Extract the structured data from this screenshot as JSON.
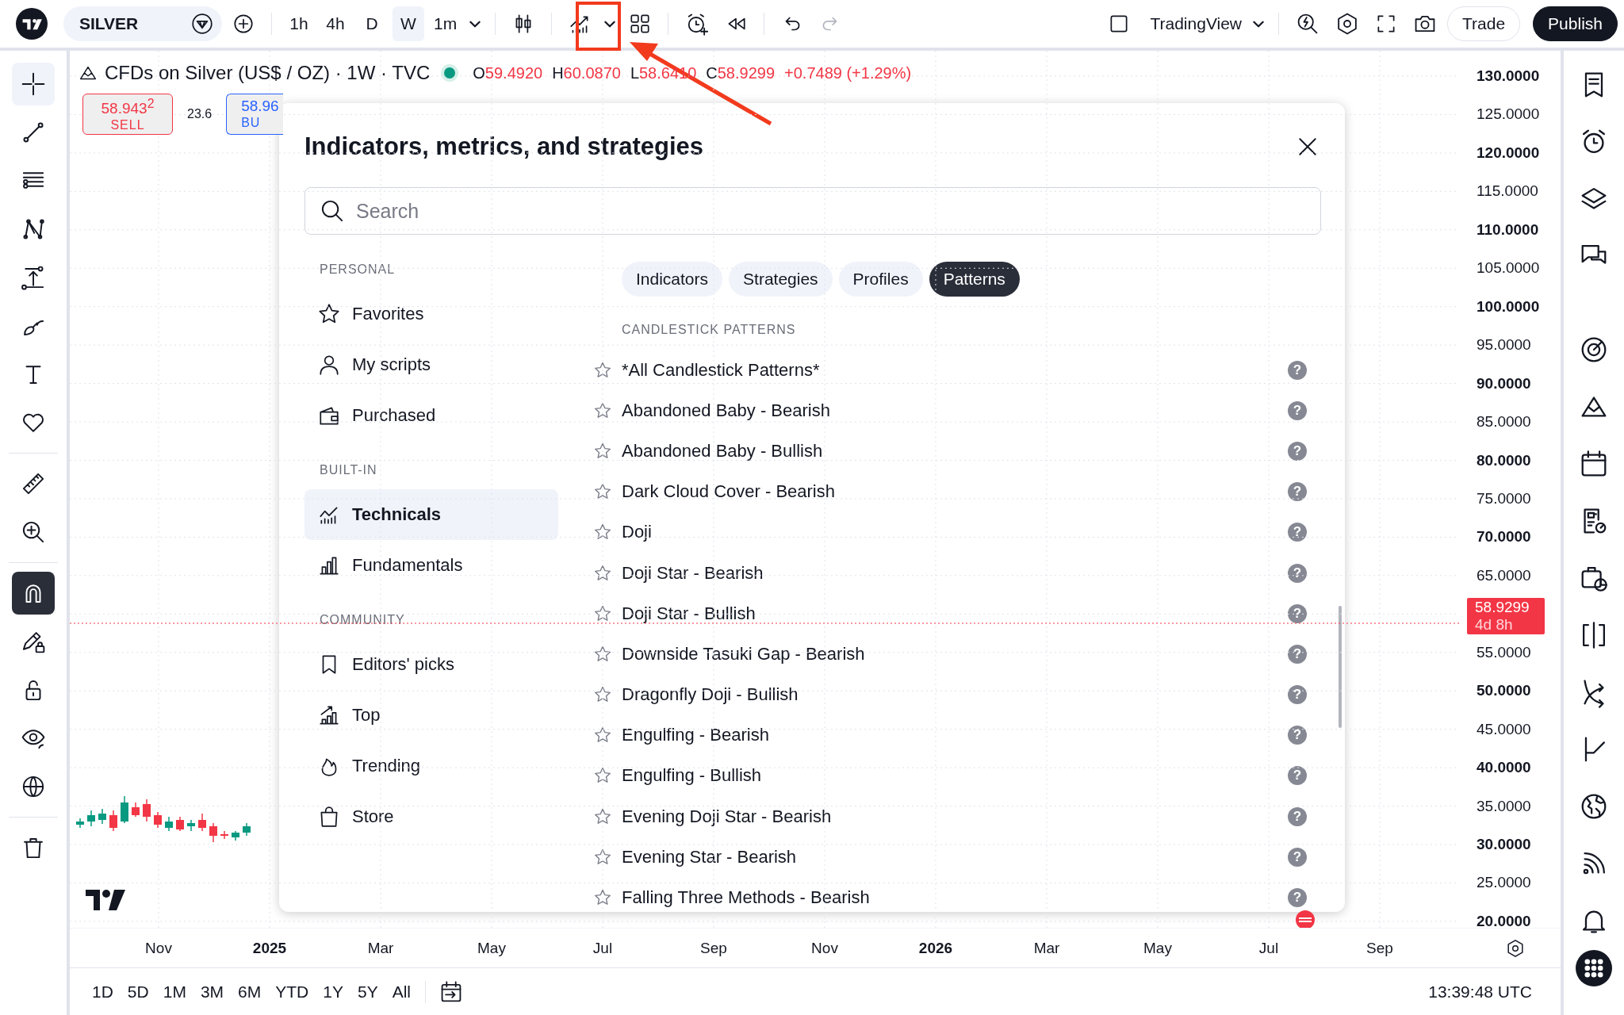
{
  "toolbar": {
    "symbol": "SILVER",
    "intervals": [
      {
        "label": "1h",
        "selected": false
      },
      {
        "label": "4h",
        "selected": false
      },
      {
        "label": "D",
        "selected": false
      },
      {
        "label": "W",
        "selected": true
      },
      {
        "label": "1m",
        "selected": false
      }
    ],
    "redo_disabled": true,
    "layout_name": "TradingView",
    "trade": "Trade",
    "publish": "Publish"
  },
  "drawing_tools": [
    {
      "selected": true,
      "on": false
    },
    {
      "selected": false,
      "on": false
    },
    {
      "selected": false,
      "on": false
    },
    {
      "selected": false,
      "on": false
    },
    {
      "selected": false,
      "on": false
    },
    {
      "selected": false,
      "on": false
    },
    {
      "selected": false,
      "on": false
    },
    {
      "selected": false,
      "on": false
    },
    {
      "selected": false,
      "on": false
    },
    {
      "selected": false,
      "on": false
    },
    {
      "selected": false,
      "on": true
    },
    {
      "selected": false,
      "on": false
    },
    {
      "selected": false,
      "on": false
    },
    {
      "selected": false,
      "on": false
    },
    {
      "selected": false,
      "on": false
    },
    {
      "selected": false,
      "on": false
    }
  ],
  "legend": {
    "title": "CFDs on Silver (US$ / OZ) · 1W · TVC",
    "market_open": true,
    "ohlc": [
      {
        "label": "O",
        "value": "59.4920"
      },
      {
        "label": "H",
        "value": "60.0870"
      },
      {
        "label": "L",
        "value": "58.6410"
      },
      {
        "label": "C",
        "value": "58.9299"
      }
    ],
    "change": "+0.7489 (+1.29%)"
  },
  "trade_panel": {
    "sell_price": "58.943$^{2}$",
    "sell_label": "SELL",
    "spread": "23.6",
    "buy_price": "58.96",
    "buy_label": "BU"
  },
  "price_axis": {
    "labels": [
      {
        "text": "130.0000",
        "major": true
      },
      {
        "text": "125.0000",
        "major": false
      },
      {
        "text": "120.0000",
        "major": true
      },
      {
        "text": "115.0000",
        "major": false
      },
      {
        "text": "110.0000",
        "major": true
      },
      {
        "text": "105.0000",
        "major": false
      },
      {
        "text": "100.0000",
        "major": true
      },
      {
        "text": "95.0000",
        "major": false
      },
      {
        "text": "90.0000",
        "major": true
      },
      {
        "text": "85.0000",
        "major": false
      },
      {
        "text": "80.0000",
        "major": true
      },
      {
        "text": "75.0000",
        "major": false
      },
      {
        "text": "70.0000",
        "major": true
      },
      {
        "text": "65.0000",
        "major": false
      },
      {
        "text": "55.0000",
        "major": false
      },
      {
        "text": "50.0000",
        "major": true
      },
      {
        "text": "45.0000",
        "major": false
      },
      {
        "text": "40.0000",
        "major": true
      },
      {
        "text": "35.0000",
        "major": false
      },
      {
        "text": "30.0000",
        "major": true
      },
      {
        "text": "25.0000",
        "major": false
      },
      {
        "text": "20.0000",
        "major": true
      }
    ],
    "last_price": "58.9299",
    "countdown": "4d 8h"
  },
  "time_axis": [
    {
      "text": "Nov",
      "major": false
    },
    {
      "text": "2025",
      "major": true
    },
    {
      "text": "Mar",
      "major": false
    },
    {
      "text": "May",
      "major": false
    },
    {
      "text": "Jul",
      "major": false
    },
    {
      "text": "Sep",
      "major": false
    },
    {
      "text": "Nov",
      "major": false
    },
    {
      "text": "2026",
      "major": true
    },
    {
      "text": "Mar",
      "major": false
    },
    {
      "text": "May",
      "major": false
    },
    {
      "text": "Jul",
      "major": false
    },
    {
      "text": "Sep",
      "major": false
    }
  ],
  "bottom_bar": {
    "ranges": [
      "1D",
      "5D",
      "1M",
      "3M",
      "6M",
      "YTD",
      "1Y",
      "5Y",
      "All"
    ],
    "clock": "13:39:48 UTC"
  },
  "dialog": {
    "title": "Indicators, metrics, and strategies",
    "search": {
      "placeholder": "Search"
    },
    "nav": [
      {
        "heading": "PERSONAL",
        "items": [
          {
            "label": "Favorites",
            "selected": false
          },
          {
            "label": "My scripts",
            "selected": false
          },
          {
            "label": "Purchased",
            "selected": false
          }
        ]
      },
      {
        "heading": "BUILT-IN",
        "items": [
          {
            "label": "Technicals",
            "selected": true
          },
          {
            "label": "Fundamentals",
            "selected": false
          }
        ]
      },
      {
        "heading": "COMMUNITY",
        "items": [
          {
            "label": "Editors' picks",
            "selected": false
          },
          {
            "label": "Top",
            "selected": false
          },
          {
            "label": "Trending",
            "selected": false
          },
          {
            "label": "Store",
            "selected": false
          }
        ]
      }
    ],
    "tabs": [
      {
        "label": "Indicators",
        "selected": false
      },
      {
        "label": "Strategies",
        "selected": false
      },
      {
        "label": "Profiles",
        "selected": false
      },
      {
        "label": "Patterns",
        "selected": true
      }
    ],
    "section": "CANDLESTICK PATTERNS",
    "items": [
      {
        "label": "*All Candlestick Patterns*",
        "favorite": false,
        "help": "?"
      },
      {
        "label": "Abandoned Baby - Bearish",
        "favorite": false,
        "help": "?"
      },
      {
        "label": "Abandoned Baby - Bullish",
        "favorite": false,
        "help": "?"
      },
      {
        "label": "Dark Cloud Cover - Bearish",
        "favorite": false,
        "help": "?"
      },
      {
        "label": "Doji",
        "favorite": false,
        "help": "?"
      },
      {
        "label": "Doji Star - Bearish",
        "favorite": false,
        "help": "?"
      },
      {
        "label": "Doji Star - Bullish",
        "favorite": false,
        "help": "?"
      },
      {
        "label": "Downside Tasuki Gap - Bearish",
        "favorite": false,
        "help": "?"
      },
      {
        "label": "Dragonfly Doji - Bullish",
        "favorite": false,
        "help": "?"
      },
      {
        "label": "Engulfing - Bearish",
        "favorite": false,
        "help": "?"
      },
      {
        "label": "Engulfing - Bullish",
        "favorite": false,
        "help": "?"
      },
      {
        "label": "Evening Doji Star - Bearish",
        "favorite": false,
        "help": "?"
      },
      {
        "label": "Evening Star - Bearish",
        "favorite": false,
        "help": "?"
      },
      {
        "label": "Falling Three Methods - Bearish",
        "favorite": false,
        "help": "?"
      }
    ]
  }
}
